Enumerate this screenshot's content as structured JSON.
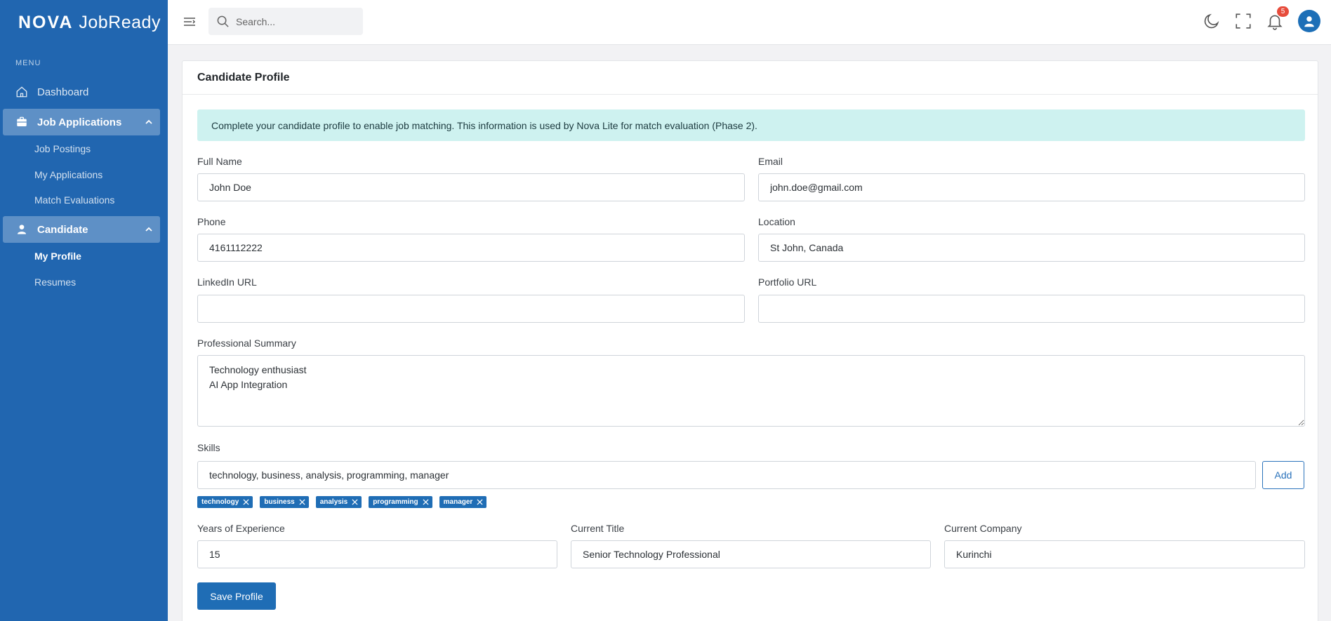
{
  "brand": {
    "name_bold": "NOVA",
    "name_regular": "JobReady"
  },
  "sidebar": {
    "menu_label": "MENU",
    "dashboard": "Dashboard",
    "job_applications": {
      "label": "Job Applications",
      "items": [
        "Job Postings",
        "My Applications",
        "Match Evaluations"
      ]
    },
    "candidate": {
      "label": "Candidate",
      "items": [
        "My Profile",
        "Resumes"
      ],
      "active": "My Profile"
    }
  },
  "topbar": {
    "search_placeholder": "Search...",
    "notification_count": "5",
    "icons": [
      "menu-icon",
      "search-icon",
      "moon-icon",
      "fullscreen-icon",
      "bell-icon",
      "user-icon"
    ]
  },
  "card": {
    "title": "Candidate Profile",
    "alert": "Complete your candidate profile to enable job matching. This information is used by Nova Lite for match evaluation (Phase 2)."
  },
  "form": {
    "full_name": {
      "label": "Full Name",
      "value": "John Doe"
    },
    "email": {
      "label": "Email",
      "value": "john.doe@gmail.com"
    },
    "phone": {
      "label": "Phone",
      "value": "4161112222"
    },
    "location": {
      "label": "Location",
      "value": "St John, Canada"
    },
    "linkedin": {
      "label": "LinkedIn URL",
      "value": ""
    },
    "portfolio": {
      "label": "Portfolio URL",
      "value": ""
    },
    "summary": {
      "label": "Professional Summary",
      "value": "Technology enthusiast\nAI App Integration"
    },
    "skills": {
      "label": "Skills",
      "value": "technology, business, analysis, programming, manager",
      "add_label": "Add",
      "tags": [
        "technology",
        "business",
        "analysis",
        "programming",
        "manager"
      ]
    },
    "years": {
      "label": "Years of Experience",
      "value": "15"
    },
    "title": {
      "label": "Current Title",
      "value": "Senior Technology Professional"
    },
    "company": {
      "label": "Current Company",
      "value": "Kurinchi"
    },
    "save_label": "Save Profile"
  },
  "colors": {
    "sidebar": "#2166b0",
    "primary": "#1f6db5",
    "alert_bg": "#cef2f0",
    "badge": "#e74c3c"
  }
}
